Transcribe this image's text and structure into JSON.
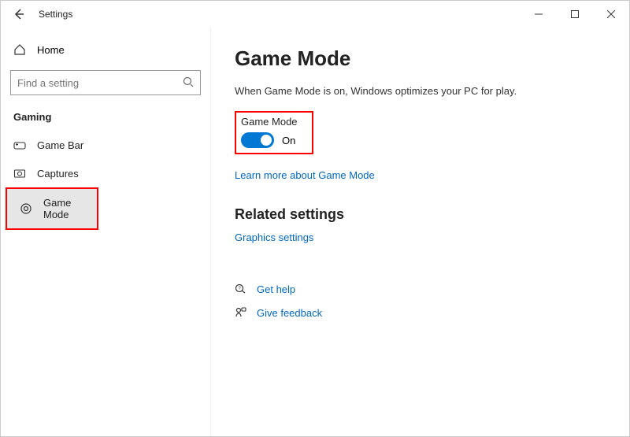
{
  "window": {
    "title": "Settings"
  },
  "sidebar": {
    "home_label": "Home",
    "search_placeholder": "Find a setting",
    "category": "Gaming",
    "items": [
      {
        "label": "Game Bar"
      },
      {
        "label": "Captures"
      },
      {
        "label": "Game Mode"
      }
    ]
  },
  "page": {
    "title": "Game Mode",
    "description": "When Game Mode is on, Windows optimizes your PC for play.",
    "toggle_label": "Game Mode",
    "toggle_state": "On",
    "learn_link": "Learn more about Game Mode",
    "related_title": "Related settings",
    "graphics_link": "Graphics settings",
    "help_link": "Get help",
    "feedback_link": "Give feedback"
  }
}
